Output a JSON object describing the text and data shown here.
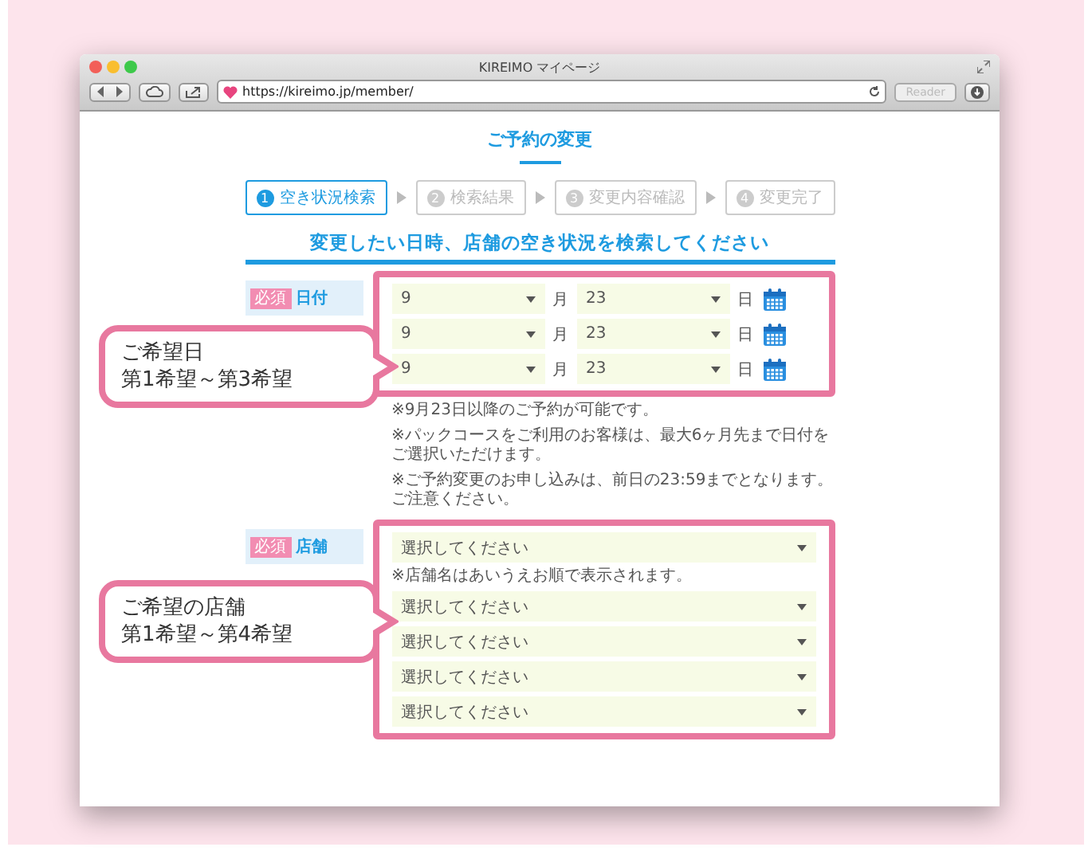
{
  "browser": {
    "title": "KIREIMO マイページ",
    "url": "https://kireimo.jp/member/",
    "reader_button": {
      "label": "Reader",
      "disabled": true
    }
  },
  "page": {
    "title": "ご予約の変更",
    "steps": [
      {
        "number": "1",
        "label": "空き状況検索",
        "selected": true
      },
      {
        "number": "2",
        "label": "検索結果",
        "selected": false
      },
      {
        "number": "3",
        "label": "変更内容確認",
        "selected": false
      },
      {
        "number": "4",
        "label": "変更完了",
        "selected": false
      }
    ],
    "heading": "変更したい日時、店舗の空き状況を検索してください",
    "date_field": {
      "badge": "必須",
      "label": "日付",
      "rows": [
        {
          "month": "9",
          "month_unit": "月",
          "day": "23",
          "day_unit": "日"
        },
        {
          "month": "9",
          "month_unit": "月",
          "day": "23",
          "day_unit": "日"
        },
        {
          "month": "9",
          "month_unit": "月",
          "day": "23",
          "day_unit": "日"
        }
      ]
    },
    "date_notes": [
      "※9月23日以降のご予約が可能です。",
      "※パックコースをご利用のお客様は、最大6ヶ月先まで日付をご選択いただけます。",
      "※ご予約変更のお申し込みは、前日の23:59までとなります。ご注意ください。"
    ],
    "store_field": {
      "badge": "必須",
      "label": "店舗",
      "note": "※店舗名はあいうえお順で表示されます。",
      "selects": [
        {
          "value": "選択してください"
        },
        {
          "value": "選択してください"
        },
        {
          "value": "選択してください"
        },
        {
          "value": "選択してください"
        },
        {
          "value": "選択してください"
        }
      ]
    }
  },
  "callouts": [
    {
      "lines": [
        "ご希望日",
        "第1希望～第3希望"
      ]
    },
    {
      "lines": [
        "ご希望の店舗",
        "第1希望～第4希望"
      ]
    }
  ]
}
